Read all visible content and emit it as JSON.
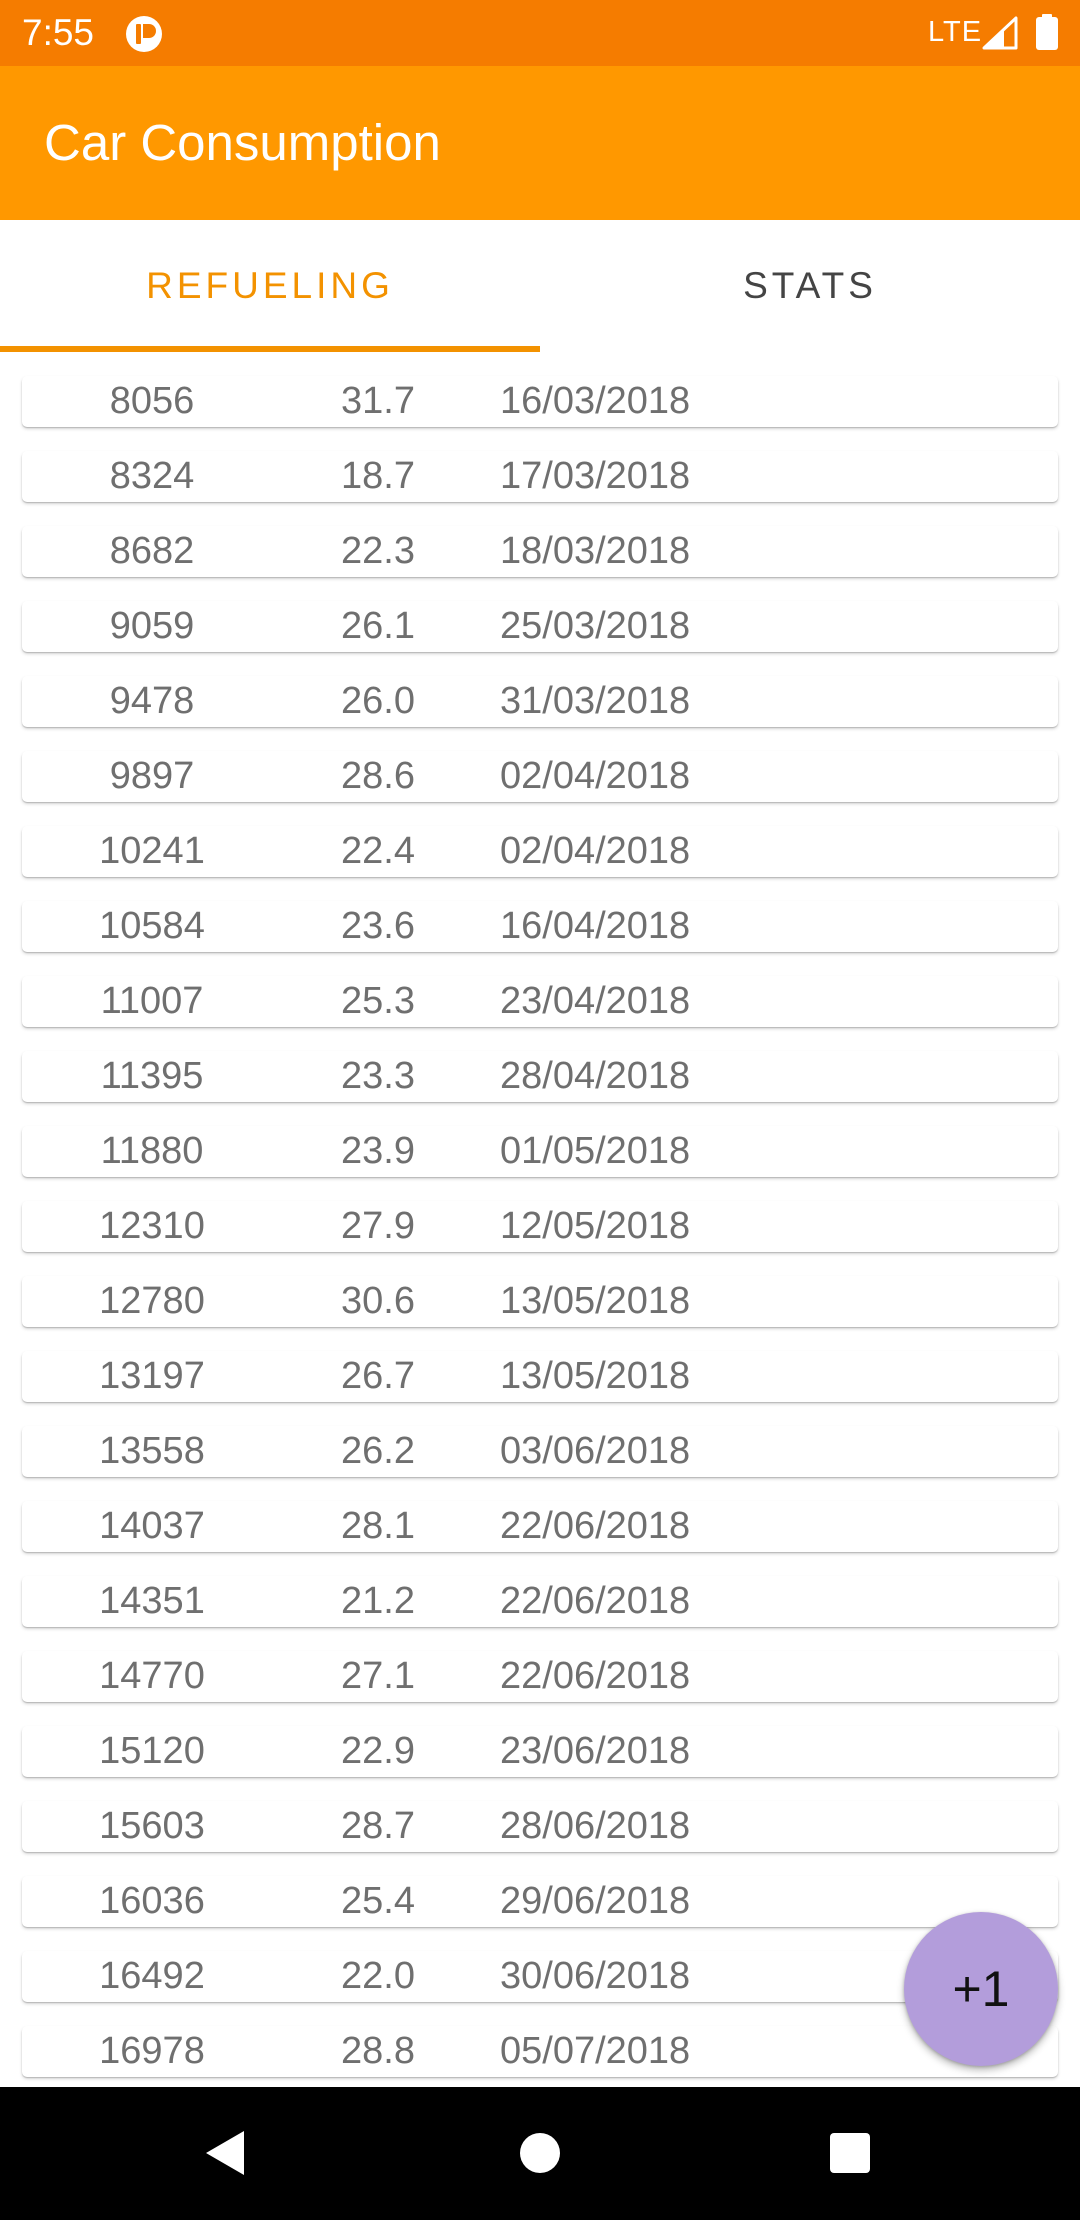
{
  "status_bar": {
    "time": "7:55",
    "network": "LTE",
    "app_icon": "notification-app-icon"
  },
  "app_bar": {
    "title": "Car Consumption",
    "color": "#ff9800"
  },
  "tabs": [
    {
      "label": "REFUELING",
      "selected": true
    },
    {
      "label": "STATS",
      "selected": false
    }
  ],
  "refuelings": [
    {
      "odometer": "8056",
      "liters": "31.7",
      "date": "16/03/2018"
    },
    {
      "odometer": "8324",
      "liters": "18.7",
      "date": "17/03/2018"
    },
    {
      "odometer": "8682",
      "liters": "22.3",
      "date": "18/03/2018"
    },
    {
      "odometer": "9059",
      "liters": "26.1",
      "date": "25/03/2018"
    },
    {
      "odometer": "9478",
      "liters": "26.0",
      "date": "31/03/2018"
    },
    {
      "odometer": "9897",
      "liters": "28.6",
      "date": "02/04/2018"
    },
    {
      "odometer": "10241",
      "liters": "22.4",
      "date": "02/04/2018"
    },
    {
      "odometer": "10584",
      "liters": "23.6",
      "date": "16/04/2018"
    },
    {
      "odometer": "11007",
      "liters": "25.3",
      "date": "23/04/2018"
    },
    {
      "odometer": "11395",
      "liters": "23.3",
      "date": "28/04/2018"
    },
    {
      "odometer": "11880",
      "liters": "23.9",
      "date": "01/05/2018"
    },
    {
      "odometer": "12310",
      "liters": "27.9",
      "date": "12/05/2018"
    },
    {
      "odometer": "12780",
      "liters": "30.6",
      "date": "13/05/2018"
    },
    {
      "odometer": "13197",
      "liters": "26.7",
      "date": "13/05/2018"
    },
    {
      "odometer": "13558",
      "liters": "26.2",
      "date": "03/06/2018"
    },
    {
      "odometer": "14037",
      "liters": "28.1",
      "date": "22/06/2018"
    },
    {
      "odometer": "14351",
      "liters": "21.2",
      "date": "22/06/2018"
    },
    {
      "odometer": "14770",
      "liters": "27.1",
      "date": "22/06/2018"
    },
    {
      "odometer": "15120",
      "liters": "22.9",
      "date": "23/06/2018"
    },
    {
      "odometer": "15603",
      "liters": "28.7",
      "date": "28/06/2018"
    },
    {
      "odometer": "16036",
      "liters": "25.4",
      "date": "29/06/2018"
    },
    {
      "odometer": "16492",
      "liters": "22.0",
      "date": "30/06/2018"
    },
    {
      "odometer": "16978",
      "liters": "28.8",
      "date": "05/07/2018"
    }
  ],
  "fab": {
    "label": "+1",
    "color": "#b39ddb"
  },
  "nav_bar": {
    "back_icon": "back-triangle-icon",
    "home_icon": "home-circle-icon",
    "recents_icon": "recents-square-icon"
  }
}
